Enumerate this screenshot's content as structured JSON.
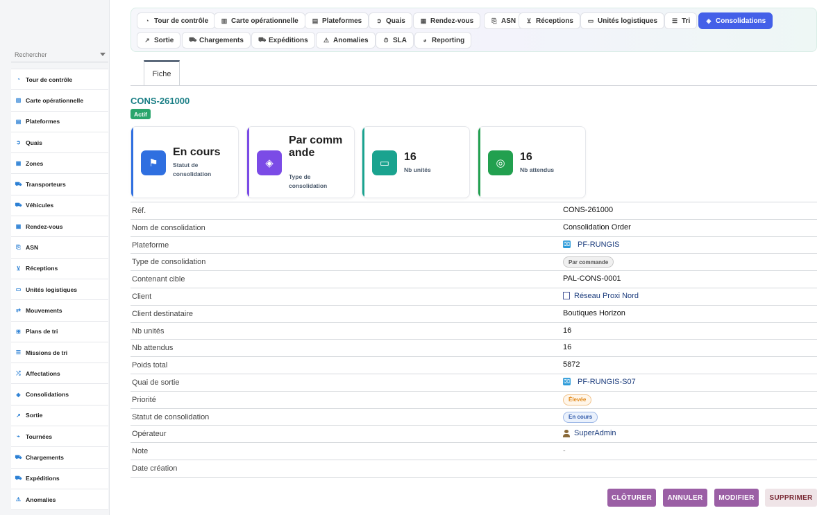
{
  "sidebar": {
    "search_placeholder": "Rechercher",
    "items": [
      {
        "label": "Tour de contrôle",
        "icon": "gauge-icon"
      },
      {
        "label": "Carte opérationnelle",
        "icon": "map-icon"
      },
      {
        "label": "Plateformes",
        "icon": "warehouse-icon"
      },
      {
        "label": "Quais",
        "icon": "dock-icon"
      },
      {
        "label": "Zones",
        "icon": "grid-icon"
      },
      {
        "label": "Transporteurs",
        "icon": "truck-icon"
      },
      {
        "label": "Véhicules",
        "icon": "bus-icon"
      },
      {
        "label": "Rendez-vous",
        "icon": "calendar-icon"
      },
      {
        "label": "ASN",
        "icon": "document-icon"
      },
      {
        "label": "Réceptions",
        "icon": "dolly-icon"
      },
      {
        "label": "Unités logistiques",
        "icon": "pallet-icon"
      },
      {
        "label": "Mouvements",
        "icon": "arrows-icon"
      },
      {
        "label": "Plans de tri",
        "icon": "sitemap-icon"
      },
      {
        "label": "Missions de tri",
        "icon": "list-icon"
      },
      {
        "label": "Affectations",
        "icon": "shuffle-icon"
      },
      {
        "label": "Consolidations",
        "icon": "layers-icon"
      },
      {
        "label": "Sortie",
        "icon": "exit-icon"
      },
      {
        "label": "Tournées",
        "icon": "route-icon"
      },
      {
        "label": "Chargements",
        "icon": "loading-icon"
      },
      {
        "label": "Expéditions",
        "icon": "shipping-icon"
      },
      {
        "label": "Anomalies",
        "icon": "warning-icon"
      }
    ]
  },
  "tabs": [
    {
      "label": "Tour de contrôle",
      "glyph": "◔"
    },
    {
      "label": "Carte opérationnelle",
      "glyph": "▥"
    },
    {
      "label": "Plateformes",
      "glyph": "▤"
    },
    {
      "label": "Quais",
      "glyph": "➲"
    },
    {
      "label": "Rendez-vous",
      "glyph": "▦"
    },
    {
      "label": "ASN",
      "glyph": "⎘"
    },
    {
      "label": "Réceptions",
      "glyph": "⊻"
    },
    {
      "label": "Unités logistiques",
      "glyph": "▭"
    },
    {
      "label": "Tri",
      "glyph": "☰"
    },
    {
      "label": "Consolidations",
      "glyph": "◈",
      "active": true
    },
    {
      "label": "Sortie",
      "glyph": "↗"
    },
    {
      "label": "Chargements",
      "glyph": "⛟"
    },
    {
      "label": "Expéditions",
      "glyph": "⛟"
    },
    {
      "label": "Anomalies",
      "glyph": "⚠"
    },
    {
      "label": "SLA",
      "glyph": "⏱"
    },
    {
      "label": "Reporting",
      "glyph": "◕"
    }
  ],
  "fiche_tab": "Fiche",
  "record": {
    "title": "CONS-261000",
    "status_badge": "Actif"
  },
  "kpis": [
    {
      "value": "En cours",
      "label": "Statut de consolidation",
      "color": "#2f6fe0",
      "icon": "flag-icon"
    },
    {
      "value": "Par commande",
      "label": "Type de consolidation",
      "color": "#7b4be6",
      "icon": "layers-icon"
    },
    {
      "value": "16",
      "label": "Nb unités",
      "color": "#1aa38f",
      "icon": "pallet-icon"
    },
    {
      "value": "16",
      "label": "Nb attendus",
      "color": "#22a04f",
      "icon": "target-icon"
    }
  ],
  "details": [
    {
      "key": "Réf.",
      "value": "CONS-261000",
      "type": "text"
    },
    {
      "key": "Nom de consolidation",
      "value": "Consolidation Order",
      "type": "text"
    },
    {
      "key": "Plateforme",
      "value": "PF-RUNGIS",
      "type": "platform-link"
    },
    {
      "key": "Type de consolidation",
      "value": "Par commande",
      "type": "pill-grey"
    },
    {
      "key": "Contenant cible",
      "value": "PAL-CONS-0001",
      "type": "text"
    },
    {
      "key": "Client",
      "value": "Réseau Proxi Nord",
      "type": "client-link"
    },
    {
      "key": "Client destinataire",
      "value": "Boutiques Horizon",
      "type": "text"
    },
    {
      "key": "Nb unités",
      "value": "16",
      "type": "text"
    },
    {
      "key": "Nb attendus",
      "value": "16",
      "type": "text"
    },
    {
      "key": "Poids total",
      "value": "5872",
      "type": "text"
    },
    {
      "key": "Quai de sortie",
      "value": "PF-RUNGIS-S07",
      "type": "platform-link"
    },
    {
      "key": "Priorité",
      "value": "Élevée",
      "type": "pill-orange"
    },
    {
      "key": "Statut de consolidation",
      "value": "En cours",
      "type": "pill-blue"
    },
    {
      "key": "Opérateur",
      "value": "SuperAdmin",
      "type": "user-link"
    },
    {
      "key": "Note",
      "value": "-",
      "type": "muted"
    },
    {
      "key": "Date création",
      "value": "",
      "type": "text"
    }
  ],
  "actions": [
    {
      "label": "CLÔTURER",
      "color": "#9b5fa5"
    },
    {
      "label": "ANNULER",
      "color": "#9b5fa5"
    },
    {
      "label": "MODIFIER",
      "color": "#9b5fa5"
    },
    {
      "label": "SUPPRIMER",
      "color": "#efe4e7",
      "text_color": "#7a2a35"
    }
  ]
}
